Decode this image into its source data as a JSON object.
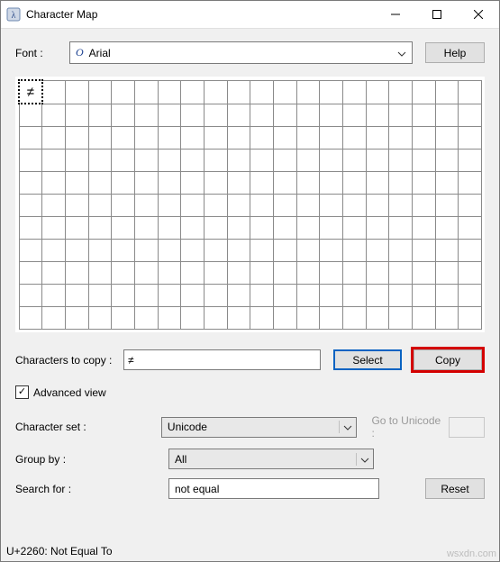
{
  "titlebar": {
    "title": "Character Map"
  },
  "font": {
    "label": "Font :",
    "selected": "Arial",
    "help_label": "Help"
  },
  "grid": {
    "cols": 20,
    "rows": 11,
    "selected_char": "≠"
  },
  "copy": {
    "label": "Characters to copy :",
    "value": "≠",
    "select_label": "Select",
    "copy_label": "Copy"
  },
  "advanced": {
    "checked": true,
    "label": "Advanced view"
  },
  "charset": {
    "label": "Character set :",
    "value": "Unicode",
    "go_label": "Go to Unicode :"
  },
  "groupby": {
    "label": "Group by :",
    "value": "All"
  },
  "search": {
    "label": "Search for :",
    "value": "not equal",
    "reset_label": "Reset"
  },
  "status": {
    "text": "U+2260: Not Equal To"
  },
  "watermark": "wsxdn.com"
}
